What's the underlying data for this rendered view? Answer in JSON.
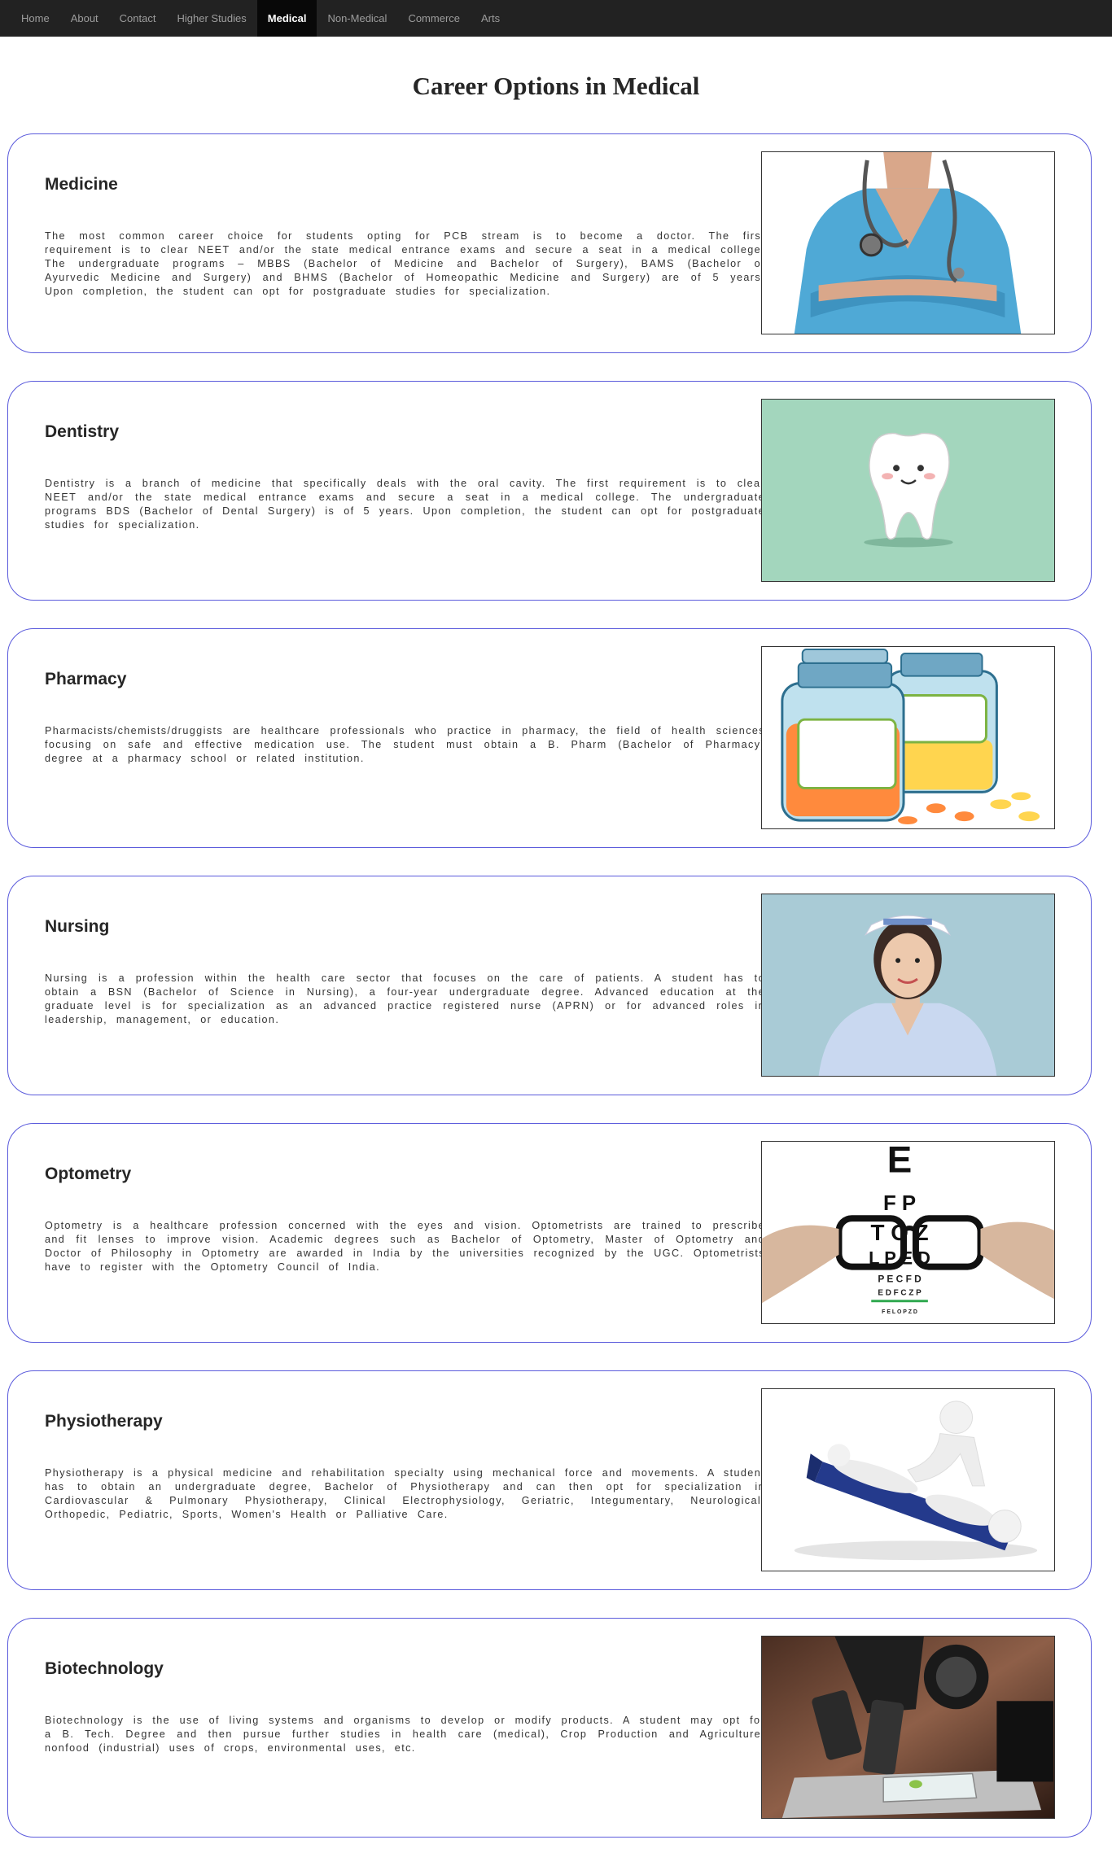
{
  "nav": {
    "items": [
      "Home",
      "About",
      "Contact",
      "Higher Studies",
      "Medical",
      "Non-Medical",
      "Commerce",
      "Arts"
    ],
    "active_index": 4
  },
  "page": {
    "title": "Career Options in Medical"
  },
  "cards": [
    {
      "title": "Medicine",
      "text": "The most common career choice for students opting for PCB stream is to become a doctor. The first requirement is to clear NEET and/or the state medical entrance exams and secure a seat in a medical college. The undergraduate programs – MBBS (Bachelor of Medicine and Bachelor of Surgery), BAMS (Bachelor of Ayurvedic Medicine and Surgery) and BHMS (Bachelor of Homeopathic Medicine and Surgery) are of 5 years. Upon completion, the student can opt for postgraduate studies for specialization.",
      "image": "doctor-with-stethoscope-photo"
    },
    {
      "title": "Dentistry",
      "text": "Dentistry is a branch of medicine that specifically deals with the oral cavity. The first requirement is to clear NEET and/or the state medical entrance exams and secure a seat in a medical college. The undergraduate programs BDS (Bachelor of Dental Surgery) is of 5 years. Upon completion, the student can opt for postgraduate studies for specialization.",
      "image": "cartoon-tooth-illustration"
    },
    {
      "title": "Pharmacy",
      "text": "Pharmacists/chemists/druggists are healthcare professionals who practice in pharmacy, the field of health sciences focusing on safe and effective medication use. The student must obtain a B. Pharm (Bachelor of Pharmacy) degree at a pharmacy school or related institution.",
      "image": "pill-bottles-illustration"
    },
    {
      "title": "Nursing",
      "text": "Nursing is a profession within the health care sector that focuses on the care of patients. A student has to obtain a BSN (Bachelor of Science in Nursing), a four-year undergraduate degree. Advanced education at the graduate level is for specialization as an advanced practice registered nurse (APRN) or for advanced roles in leadership, management, or education.",
      "image": "nurse-photo"
    },
    {
      "title": "Optometry",
      "text": "Optometry is a healthcare profession concerned with the eyes and vision. Optometrists are trained to prescribe and fit lenses to improve vision. Academic degrees such as Bachelor of Optometry, Master of Optometry and Doctor of Philosophy in Optometry are awarded in India by the universities recognized by the UGC. Optometrists have to register with the Optometry Council of India.",
      "image": "eye-chart-glasses-photo"
    },
    {
      "title": "Physiotherapy",
      "text": "Physiotherapy is a physical medicine and rehabilitation specialty using mechanical force and movements. A student has to obtain an undergraduate degree, Bachelor of Physiotherapy and can then opt for specialization in Cardiovascular & Pulmonary Physiotherapy, Clinical Electrophysiology, Geriatric, Integumentary, Neurological, Orthopedic, Pediatric, Sports, Women's Health or Palliative Care.",
      "image": "physiotherapy-3d-figures"
    },
    {
      "title": "Biotechnology",
      "text": "Biotechnology is the use of living systems and organisms to develop or modify products. A student may opt for a B. Tech. Degree and then pursue further studies in health care (medical), Crop Production and Agriculture, nonfood (industrial) uses of crops, environmental uses, etc.",
      "image": "microscope-photo"
    }
  ],
  "eye_chart": {
    "rows": [
      "E",
      "F P",
      "T O Z",
      "L P E D",
      "P E C F D",
      "E D F C Z P",
      "F E L O P Z D"
    ]
  }
}
